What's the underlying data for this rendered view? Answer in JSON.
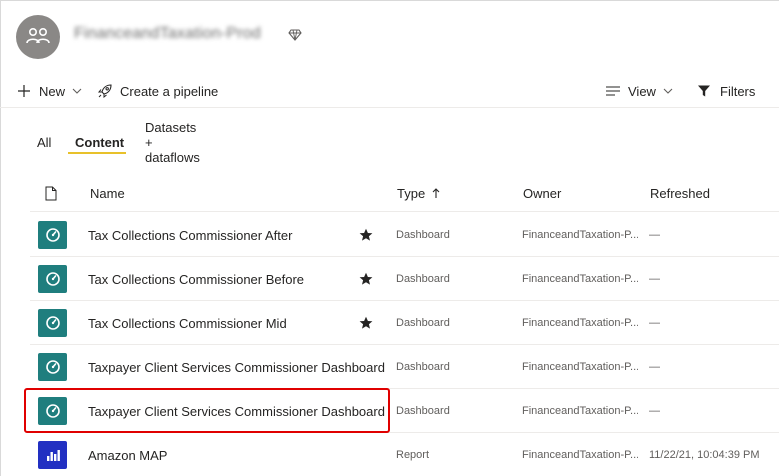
{
  "workspace": {
    "name": "FinanceandTaxation-Prod",
    "premium_icon": "diamond-icon",
    "avatar_icon": "group-icon"
  },
  "toolbar": {
    "new_label": "New",
    "create_pipeline_label": "Create a pipeline",
    "view_label": "View",
    "filters_label": "Filters"
  },
  "tabs": [
    {
      "label": "All",
      "active": false
    },
    {
      "label": "Content",
      "active": true
    },
    {
      "label": "Datasets + dataflows",
      "active": false
    }
  ],
  "columns": {
    "name": "Name",
    "type": "Type",
    "owner": "Owner",
    "refreshed": "Refreshed"
  },
  "rows": [
    {
      "icon": "dashboard-icon",
      "icon_color": "#1f7e7e",
      "name": "Tax Collections Commissioner After",
      "favorite": true,
      "type": "Dashboard",
      "owner": "FinanceandTaxation-P...",
      "refreshed": "—"
    },
    {
      "icon": "dashboard-icon",
      "icon_color": "#1f7e7e",
      "name": "Tax Collections Commissioner Before",
      "favorite": true,
      "type": "Dashboard",
      "owner": "FinanceandTaxation-P...",
      "refreshed": "—"
    },
    {
      "icon": "dashboard-icon",
      "icon_color": "#1f7e7e",
      "name": "Tax Collections Commissioner Mid",
      "favorite": true,
      "type": "Dashboard",
      "owner": "FinanceandTaxation-P...",
      "refreshed": "—"
    },
    {
      "icon": "dashboard-icon",
      "icon_color": "#1f7e7e",
      "name": "Taxpayer Client Services Commissioner Dashboard ...",
      "favorite": false,
      "type": "Dashboard",
      "owner": "FinanceandTaxation-P...",
      "refreshed": "—"
    },
    {
      "icon": "dashboard-icon",
      "icon_color": "#1f7e7e",
      "name": "Taxpayer Client Services Commissioner Dashboard ...",
      "favorite": false,
      "type": "Dashboard",
      "owner": "FinanceandTaxation-P...",
      "refreshed": "—"
    },
    {
      "icon": "report-icon",
      "icon_color": "#2230c2",
      "name": "Amazon MAP",
      "favorite": false,
      "type": "Report",
      "owner": "FinanceandTaxation-P...",
      "refreshed": "11/22/21, 10:04:39 PM"
    }
  ],
  "colors": {
    "accent_tab": "#e8c12a",
    "highlight": "#e00000"
  }
}
